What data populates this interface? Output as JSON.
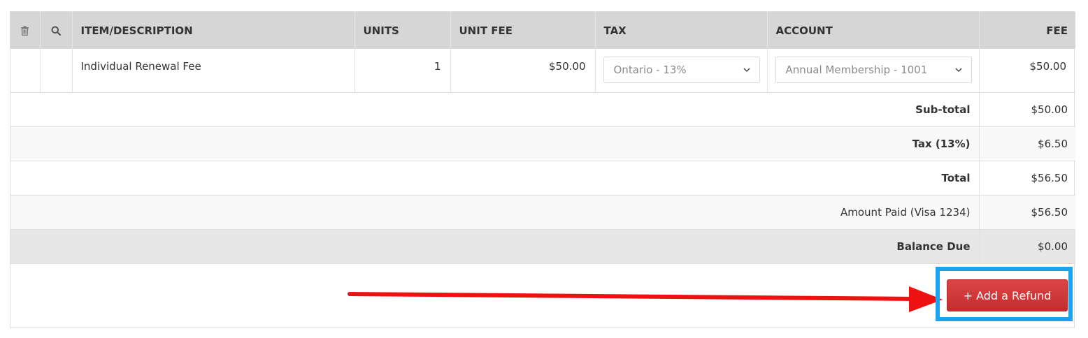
{
  "table": {
    "headers": {
      "delete_col": "",
      "search_col": "",
      "item": "ITEM/DESCRIPTION",
      "units": "UNITS",
      "unit_fee": "UNIT FEE",
      "tax": "TAX",
      "account": "ACCOUNT",
      "fee": "FEE"
    },
    "rows": [
      {
        "item": "Individual Renewal Fee",
        "units": "1",
        "unit_fee": "$50.00",
        "tax": "Ontario - 13%",
        "account": "Annual Membership - 1001",
        "fee": "$50.00"
      }
    ]
  },
  "summary": {
    "subtotal_label": "Sub-total",
    "subtotal_value": "$50.00",
    "tax_label": "Tax (13%)",
    "tax_value": "$6.50",
    "total_label": "Total",
    "total_value": "$56.50",
    "paid_label": "Amount Paid (Visa 1234)",
    "paid_value": "$56.50",
    "balance_label": "Balance Due",
    "balance_value": "$0.00"
  },
  "actions": {
    "add_refund_label": "+ Add a Refund"
  },
  "icons": {
    "delete": "trash-icon",
    "search": "search-icon",
    "dropdown": "chevron-down-icon"
  },
  "colors": {
    "header_bg": "#d6d6d6",
    "refund_button": "#d43a3a",
    "highlight": "#1aa3ef",
    "arrow": "#ee1111"
  }
}
